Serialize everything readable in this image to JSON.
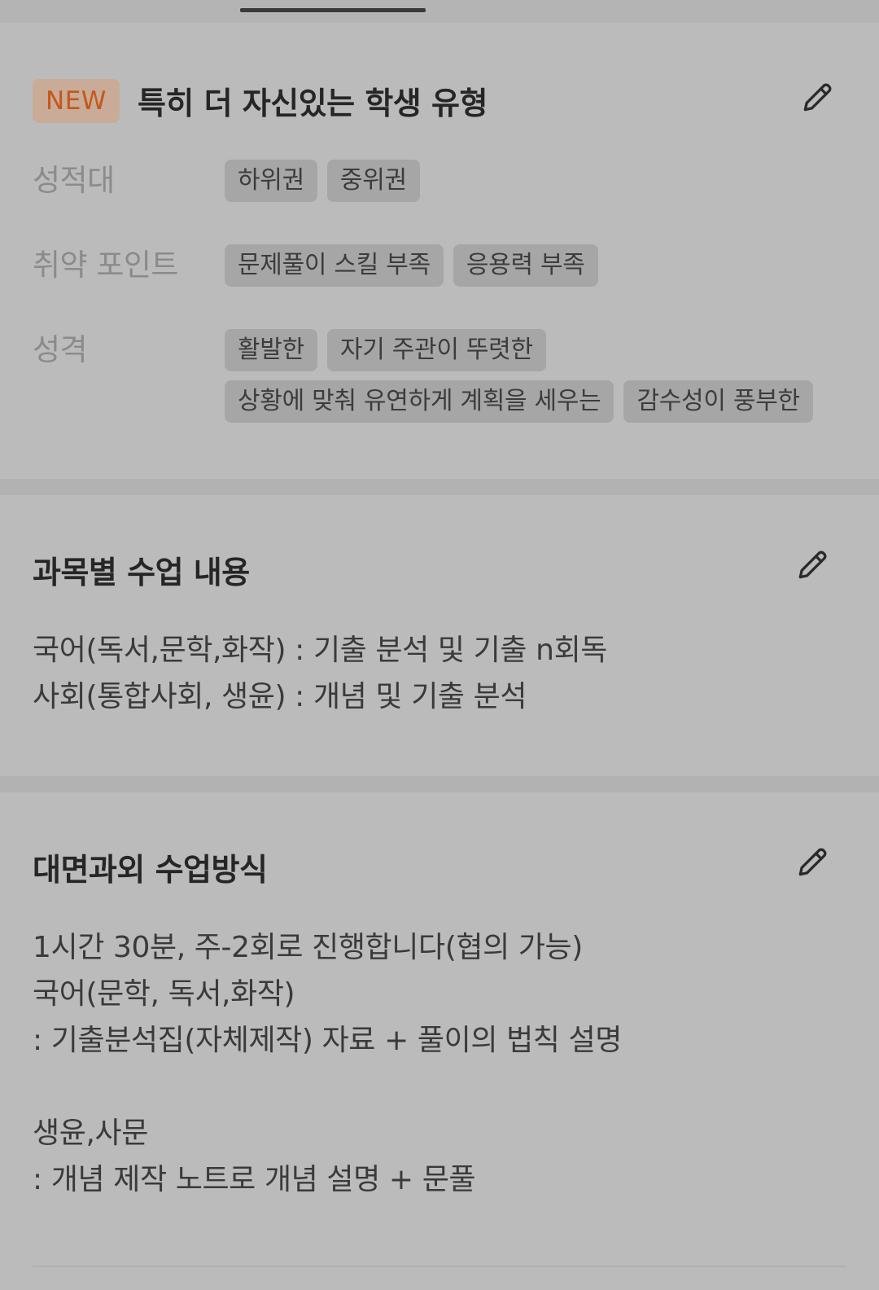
{
  "student_type": {
    "badge": "NEW",
    "title": "특히 더 자신있는 학생 유형",
    "attributes": [
      {
        "label": "성적대",
        "chips": [
          "하위권",
          "중위권"
        ]
      },
      {
        "label": "취약 포인트",
        "chips": [
          "문제풀이 스킬 부족",
          "응용력 부족"
        ]
      },
      {
        "label": "성격",
        "chips": [
          "활발한",
          "자기 주관이 뚜렷한",
          "상황에 맞춰 유연하게 계획을 세우는",
          "감수성이 풍부한"
        ]
      }
    ]
  },
  "subjects": {
    "title": "과목별 수업 내용",
    "lines": [
      "국어(독서,문학,화작) : 기출 분석 및 기출 n회독",
      "사회(통합사회, 생윤) : 개념 및 기출 분석"
    ]
  },
  "method": {
    "title": "대면과외 수업방식",
    "lines": [
      "1시간 30분, 주-2회로 진행합니다(협의 가능)",
      "국어(문학, 독서,화작)",
      ": 기출분석집(자체제작) 자료 + 풀이의 법칙 설명",
      "",
      "생윤,사문",
      ": 개념 제작 노트로 개념 설명 + 문풀"
    ]
  },
  "icons": {
    "edit": "pencil-icon"
  },
  "colors": {
    "background": "#bbbbbb",
    "badge_bg": "#c9ab98",
    "badge_text": "#c4581a",
    "chip_bg": "#a6a6a6"
  }
}
